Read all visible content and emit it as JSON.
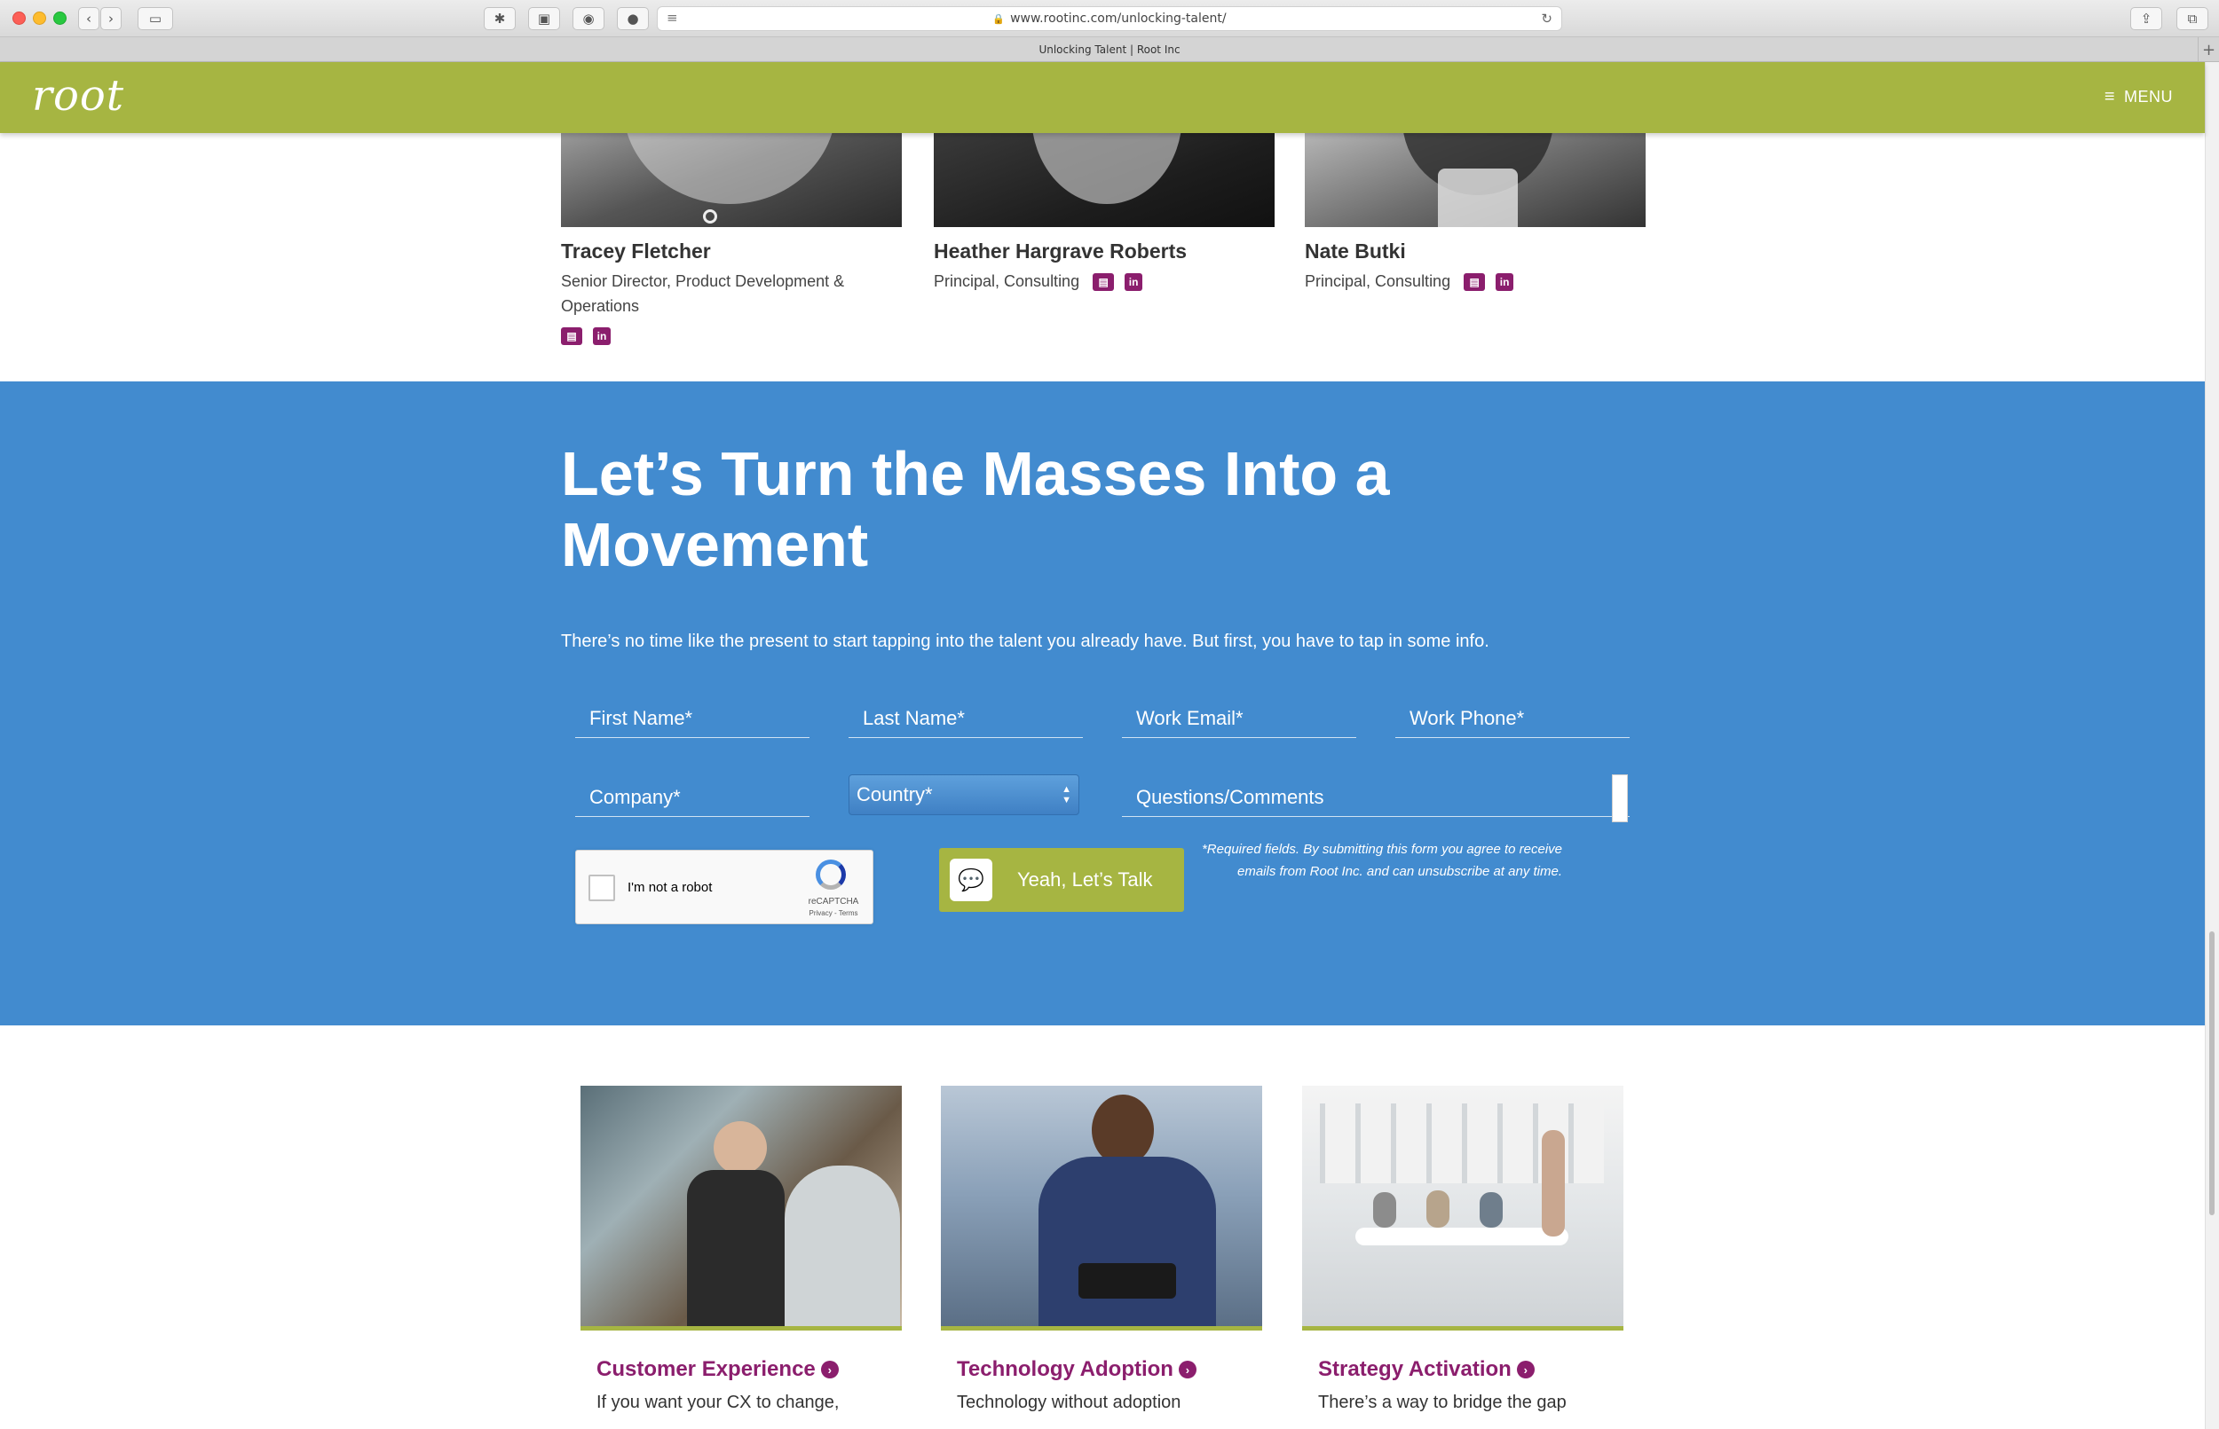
{
  "browser": {
    "url": "www.rootinc.com/unlocking-talent/",
    "tab_title": "Unlocking Talent | Root Inc"
  },
  "header": {
    "logo": "root",
    "menu_label": "MENU",
    "brand_color": "#a6b542"
  },
  "team": [
    {
      "name": "Tracey Fletcher",
      "title": "Senior Director, Product Development & Operations"
    },
    {
      "name": "Heather Hargrave Roberts",
      "title": "Principal, Consulting"
    },
    {
      "name": "Nate Butki",
      "title": "Principal, Consulting"
    }
  ],
  "cta": {
    "heading": "Let’s Turn the Masses Into a Movement",
    "lede": "There’s no time like the present to start tapping into the talent you already have. But first, you have to tap in some info.",
    "fields": {
      "first_name": "First Name*",
      "last_name": "Last Name*",
      "work_email": "Work Email*",
      "work_phone": "Work Phone*",
      "company": "Company*",
      "country": "Country*",
      "comments": "Questions/Comments"
    },
    "recaptcha": {
      "label": "I'm not a robot",
      "brand": "reCAPTCHA",
      "legal": "Privacy - Terms"
    },
    "submit_label": "Yeah, Let’s Talk",
    "disclaimer": "*Required fields. By submitting this form you agree to receive emails from Root Inc. and can unsubscribe at any time.",
    "bg_color": "#428bcf"
  },
  "services": [
    {
      "title": "Customer Experience",
      "desc": "If you want your CX to change,"
    },
    {
      "title": "Technology Adoption",
      "desc": "Technology without adoption"
    },
    {
      "title": "Strategy Activation",
      "desc": "There’s a way to bridge the gap"
    }
  ],
  "accent_color": "#8b1e6d"
}
